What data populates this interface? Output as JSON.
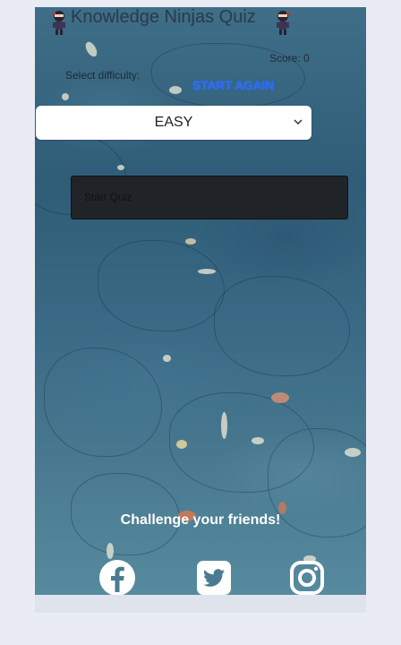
{
  "app": {
    "title": "Knowledge Ninjas Quiz",
    "score_label": "Score: 0",
    "difficulty_label": "Select difficulty:",
    "restart_label": "START AGAIN",
    "difficulty": {
      "selected": "EASY"
    },
    "start_quiz_label": "Start Quiz",
    "challenge_text": "Challenge your friends!",
    "social": [
      "facebook-icon",
      "twitter-icon",
      "instagram-icon"
    ]
  },
  "colors": {
    "page_bg": "#e9ecf3",
    "restart_blue": "#2a6cff",
    "start_button_bg": "#202428"
  }
}
